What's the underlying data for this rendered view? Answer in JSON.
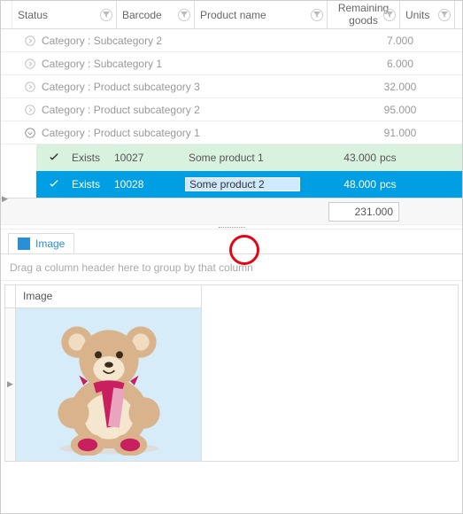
{
  "columns": {
    "status": "Status",
    "barcode": "Barcode",
    "product": "Product name",
    "remaining": "Remaining goods",
    "units": "Units"
  },
  "groups": [
    {
      "label": "Category : Subcategory 2",
      "value": "7.000",
      "expanded": false
    },
    {
      "label": "Category : Subcategory 1",
      "value": "6.000",
      "expanded": false
    },
    {
      "label": "Category : Product subcategory 3",
      "value": "32.000",
      "expanded": false
    },
    {
      "label": "Category : Product subcategory 2",
      "value": "95.000",
      "expanded": false
    },
    {
      "label": "Category : Product subcategory 1",
      "value": "91.000",
      "expanded": true
    }
  ],
  "rows": [
    {
      "status": "Exists",
      "barcode": "10027",
      "product": "Some product 1",
      "remaining": "43.000",
      "units": "pcs"
    },
    {
      "status": "Exists",
      "barcode": "10028",
      "product": "Some product 2",
      "remaining": "48.000",
      "units": "pcs"
    }
  ],
  "total": "231.000",
  "tab": {
    "label": "Image"
  },
  "hint": "Drag a column header here to group by that column",
  "imagecol": "Image"
}
